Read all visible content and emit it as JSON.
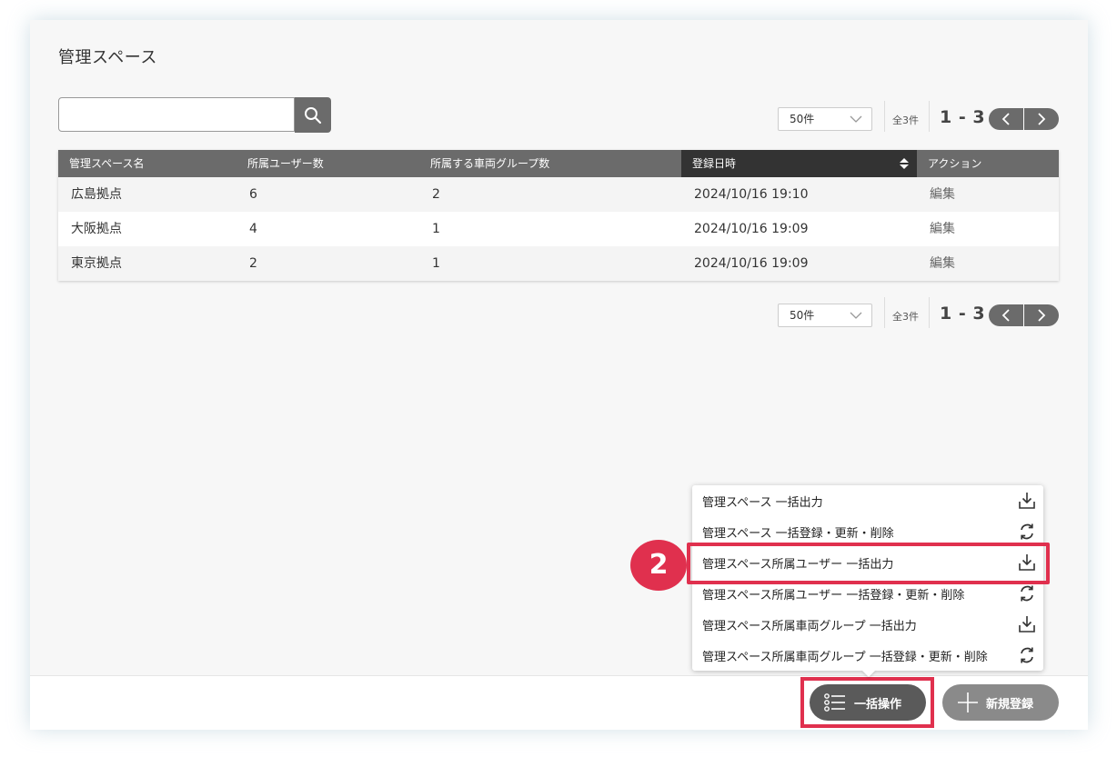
{
  "page": {
    "title": "管理スペース"
  },
  "search": {
    "placeholder": ""
  },
  "pagination": {
    "per_page": "50件",
    "total": "全3件",
    "range": "1 - 3"
  },
  "table": {
    "columns": [
      "管理スペース名",
      "所属ユーザー数",
      "所属する車両グループ数",
      "登録日時",
      "アクション"
    ],
    "sorted_column": "登録日時",
    "rows": [
      {
        "name": "広島拠点",
        "users": "6",
        "groups": "2",
        "date": "2024/10/16 19:10",
        "action": "編集"
      },
      {
        "name": "大阪拠点",
        "users": "4",
        "groups": "1",
        "date": "2024/10/16 19:09",
        "action": "編集"
      },
      {
        "name": "東京拠点",
        "users": "2",
        "groups": "1",
        "date": "2024/10/16 19:09",
        "action": "編集"
      }
    ]
  },
  "menu": {
    "items": [
      {
        "label": "管理スペース 一括出力",
        "icon": "download-icon"
      },
      {
        "label": "管理スペース 一括登録・更新・削除",
        "icon": "refresh-icon"
      },
      {
        "label": "管理スペース所属ユーザー 一括出力",
        "icon": "download-icon"
      },
      {
        "label": "管理スペース所属ユーザー 一括登録・更新・削除",
        "icon": "refresh-icon"
      },
      {
        "label": "管理スペース所属車両グループ 一括出力",
        "icon": "download-icon"
      },
      {
        "label": "管理スペース所属車両グループ 一括登録・更新・削除",
        "icon": "refresh-icon"
      }
    ]
  },
  "footer": {
    "bulk_label": "一括操作",
    "new_label": "新規登録"
  },
  "annotation": {
    "step": "2"
  },
  "colors": {
    "accent": "#e0304e",
    "header": "#6b6b6b",
    "header_sorted": "#333333",
    "button_dark": "#5a5a5a",
    "button_light": "#8a8a8a"
  }
}
